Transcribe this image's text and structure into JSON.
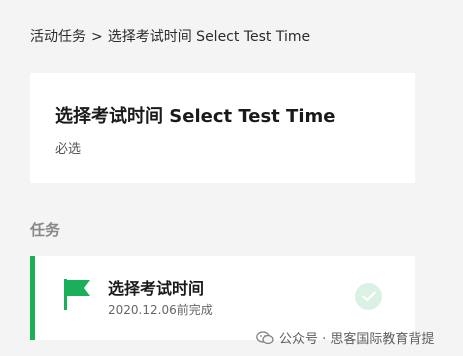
{
  "breadcrumb": {
    "parent": "活动任务",
    "separator": ">",
    "current": "选择考试时间 Select Test Time"
  },
  "header": {
    "title": "选择考试时间 Select Test Time",
    "subtitle": "必选"
  },
  "section": {
    "title": "任务"
  },
  "task": {
    "title": "选择考试时间",
    "date_status": "2020.12.06前完成",
    "status_icon": "check-icon",
    "accent_color": "#1ab05a"
  },
  "watermark": {
    "text": "公众号 · 思客国际教育背提"
  }
}
